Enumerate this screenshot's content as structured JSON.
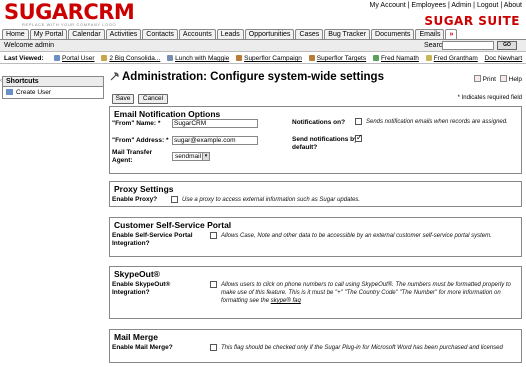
{
  "header": {
    "logo": "SUGARCRM",
    "logo_tag": "REPLACE WITH YOUR COMPANY LOGO",
    "suite_logo": "SUGAR SUITE",
    "top_links": [
      "My Account",
      "Employees",
      "Admin",
      "Logout",
      "About"
    ]
  },
  "tabs": [
    "Home",
    "My Portal",
    "Calendar",
    "Activities",
    "Contacts",
    "Accounts",
    "Leads",
    "Opportunities",
    "Cases",
    "Bug Tracker",
    "Documents",
    "Emails",
    "»"
  ],
  "welcome": {
    "text": "Welcome admin",
    "search_label": "Search",
    "search_value": "",
    "go_label": "GO"
  },
  "last_viewed": {
    "label": "Last Viewed:",
    "items": [
      "Portal User",
      "2 Big Consolida...",
      "Lunch with Maggie",
      "Superflor Campaign",
      "Superflor Targets",
      "Fred Namath",
      "Fred Grantham",
      "Doc Newhart"
    ]
  },
  "shortcuts": {
    "title": "Shortcuts",
    "items": [
      "Create User"
    ]
  },
  "page": {
    "title": "Administration: Configure system-wide settings",
    "print_label": "Print",
    "help_label": "Help",
    "save_label": "Save",
    "cancel_label": "Cancel",
    "required_note": "* Indicates required field"
  },
  "email": {
    "title": "Email Notification Options",
    "from_name_label": "\"From\" Name: *",
    "from_name_value": "SugarCRM",
    "from_address_label": "\"From\" Address: *",
    "from_address_value": "sugar@example.com",
    "mta_label": "Mail Transfer Agent:",
    "mta_value": "sendmail",
    "notifications_on_label": "Notifications on?",
    "notifications_on_desc": "Sends notification emails when records are assigned.",
    "send_default_label": "Send notifications by default?"
  },
  "proxy": {
    "title": "Proxy Settings",
    "enable_label": "Enable Proxy?",
    "enable_desc": "Use a proxy to access external information such as Sugar updates."
  },
  "portal": {
    "title": "Customer Self-Service Portal",
    "enable_label": "Enable Self-Service Portal Integration?",
    "enable_desc": "Allows Case, Note and other data to be accessible by an external customer self-service portal system."
  },
  "skype": {
    "title": "SkypeOut®",
    "enable_label": "Enable SkypeOut® Integration?",
    "enable_desc": "Allows users to click on phone numbers to call using SkypeOut®. The numbers must be formatted properly to make use of this feature. This is it must be \"+\" \"The Country Code\" \"The Number\" for more information on formatting see the",
    "faq_link": "skype® faq"
  },
  "mailmerge": {
    "title": "Mail Merge",
    "enable_label": "Enable Mail Merge?",
    "enable_desc": "This flag should be checked only if the Sugar Plug-in for Microsoft Word has been purchased and licensed"
  }
}
